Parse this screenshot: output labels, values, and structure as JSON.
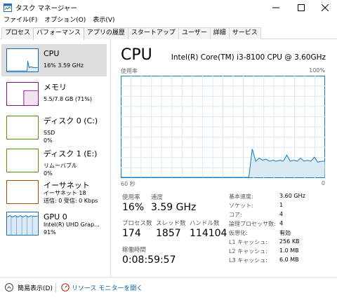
{
  "window": {
    "title": "タスク マネージャー",
    "min_glyph": "—",
    "max_glyph": "☐",
    "close_glyph": "✕"
  },
  "menu": [
    "ファイル(F)",
    "オプション(O)",
    "表示(V)"
  ],
  "tabs": [
    "プロセス",
    "パフォーマンス",
    "アプリの履歴",
    "スタートアップ",
    "ユーザー",
    "詳細",
    "サービス"
  ],
  "active_tab_index": 1,
  "sidebar": [
    {
      "label": "CPU",
      "sub1": "16%  3.59 GHz",
      "sub2": "",
      "color": "#1170b8",
      "selected": true
    },
    {
      "label": "メモリ",
      "sub1": "5.5/7.8 GB (71%)",
      "sub2": "",
      "color": "#8b128b",
      "selected": false
    },
    {
      "label": "ディスク 0 (C:)",
      "sub1": "SSD",
      "sub2": "0%",
      "color": "#4e9a06",
      "selected": false
    },
    {
      "label": "ディスク 1 (E:)",
      "sub1": "リムーバブル",
      "sub2": "0%",
      "color": "#4e9a06",
      "selected": false
    },
    {
      "label": "イーサネット",
      "sub1": "イーサネット 18",
      "sub2": "送信: 0 受信: 0 Kbps",
      "color": "#a74f01",
      "selected": false
    },
    {
      "label": "GPU 0",
      "sub1": "Intel(R) UHD Grap...",
      "sub2": "91%",
      "color": "#1170b8",
      "selected": false
    }
  ],
  "main": {
    "title": "CPU",
    "model": "Intel(R) Core(TM) i3-8100 CPU @ 3.60GHz",
    "graph_label": "使用率",
    "graph_max": "100%",
    "graph_time": "60 秒",
    "graph_min": "0",
    "stats": {
      "usage_label": "使用率",
      "usage": "16%",
      "speed_label": "速度",
      "speed": "3.59 GHz",
      "processes_label": "プロセス数",
      "processes": "174",
      "threads_label": "スレッド数",
      "threads": "1857",
      "handles_label": "ハンドル数",
      "handles": "114104",
      "uptime_label": "稼働時間",
      "uptime": "0:08:59:57"
    },
    "specs": [
      {
        "label": "基本速度:",
        "value": "3.60 GHz"
      },
      {
        "label": "ソケット:",
        "value": "1"
      },
      {
        "label": "コア:",
        "value": "4"
      },
      {
        "label": "論理プロセッサ数:",
        "value": "4"
      },
      {
        "label": "仮想化:",
        "value": "有効"
      },
      {
        "label": "L1 キャッシュ:",
        "value": "256 KB"
      },
      {
        "label": "L2 キャッシュ:",
        "value": "1.0 MB"
      },
      {
        "label": "L3 キャッシュ:",
        "value": "6.0 MB"
      }
    ]
  },
  "footer": {
    "fewer": "簡易表示(D)",
    "resource_monitor": "リソース モニターを開く"
  },
  "chart_data": {
    "type": "area",
    "ylim": [
      0,
      100
    ],
    "xlim": [
      60,
      0
    ],
    "series": [
      {
        "values": [
          0,
          0,
          0,
          0,
          0,
          0,
          0,
          0,
          0,
          0,
          0,
          0,
          0,
          0,
          0,
          0,
          0,
          0,
          0,
          0,
          0,
          0,
          0,
          0,
          0,
          0,
          0,
          0,
          0,
          0,
          0,
          0,
          0,
          0,
          0,
          0,
          0,
          0,
          28,
          16,
          19,
          17,
          18,
          16,
          17,
          16,
          17,
          16,
          22,
          16,
          17,
          16,
          19,
          16,
          17,
          16,
          20,
          15,
          16,
          16
        ]
      }
    ]
  }
}
